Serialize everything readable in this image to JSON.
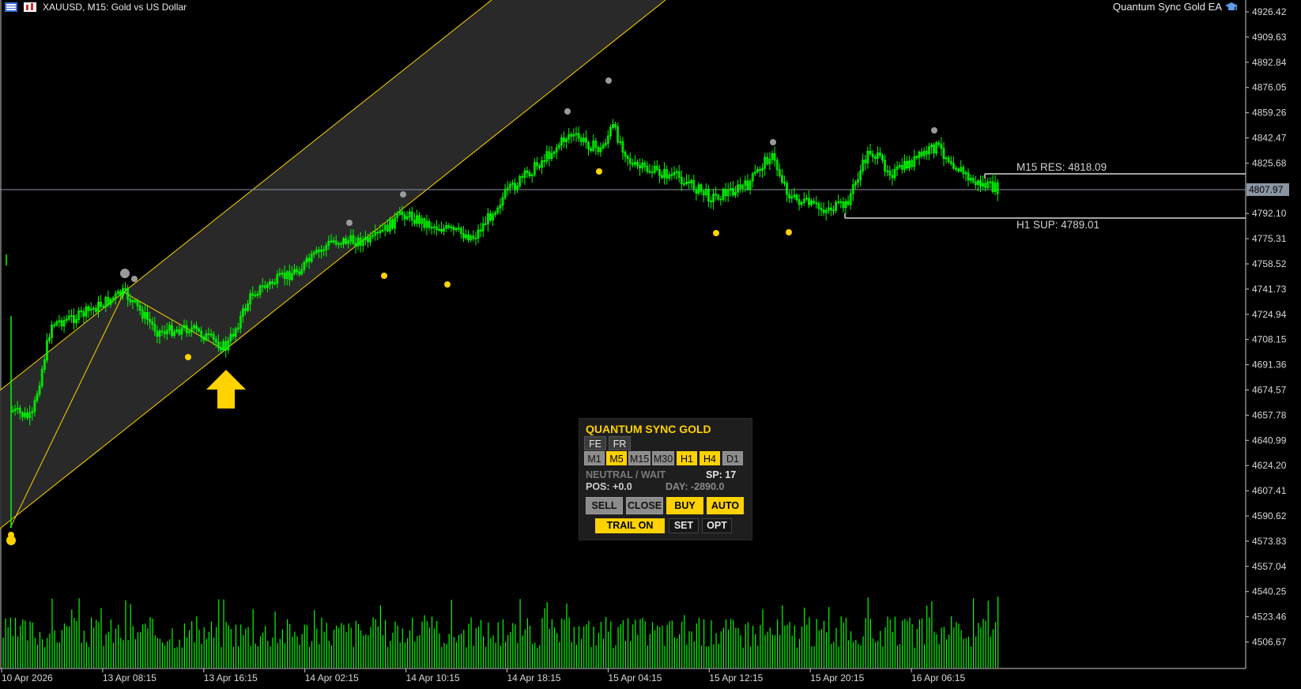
{
  "header": {
    "symbol_title": "XAUUSD, M15:  Gold vs US Dollar",
    "ea_name": "Quantum Sync Gold EA"
  },
  "price_axis": {
    "ticks": [
      "4926.42",
      "4909.63",
      "4892.84",
      "4876.05",
      "4859.26",
      "4842.47",
      "4825.68",
      "4792.10",
      "4775.31",
      "4758.52",
      "4741.73",
      "4724.94",
      "4708.15",
      "4691.36",
      "4674.57",
      "4657.78",
      "4640.99",
      "4624.20",
      "4607.41",
      "4590.62",
      "4573.83",
      "4557.04",
      "4540.25",
      "4523.46",
      "4506.67"
    ],
    "current_price": "4807.97"
  },
  "time_axis": {
    "labels": [
      "10 Apr 2026",
      "13 Apr 08:15",
      "13 Apr 16:15",
      "14 Apr 02:15",
      "14 Apr 10:15",
      "14 Apr 18:15",
      "15 Apr 04:15",
      "15 Apr 12:15",
      "15 Apr 20:15",
      "16 Apr 06:15"
    ]
  },
  "levels": {
    "resistance_label": "M15 RES: 4818.09",
    "support_label": "H1 SUP: 4789.01"
  },
  "colors": {
    "candles": "#00ff00",
    "volume": "#00ff00",
    "channel": "#ffd200",
    "accent_yellow": "#ffd200",
    "gray_dot": "#9a9a9a"
  },
  "panel": {
    "title": "QUANTUM SYNC GOLD",
    "lang_buttons": [
      "FE",
      "FR"
    ],
    "timeframes": [
      {
        "label": "M1",
        "active": false
      },
      {
        "label": "M5",
        "active": true
      },
      {
        "label": "M15",
        "active": false
      },
      {
        "label": "M30",
        "active": false
      },
      {
        "label": "H1",
        "active": true
      },
      {
        "label": "H4",
        "active": true
      },
      {
        "label": "D1",
        "active": false
      }
    ],
    "signal": "NEUTRAL / WAIT",
    "spread": "SP: 17",
    "position": "POS: +0.0",
    "day_pnl": "DAY: -2890.0",
    "actions": {
      "sell": "SELL",
      "close": "CLOSE",
      "buy": "BUY",
      "auto": "AUTO"
    },
    "trail": "TRAIL ON",
    "set": "SET",
    "opt": "OPT"
  }
}
